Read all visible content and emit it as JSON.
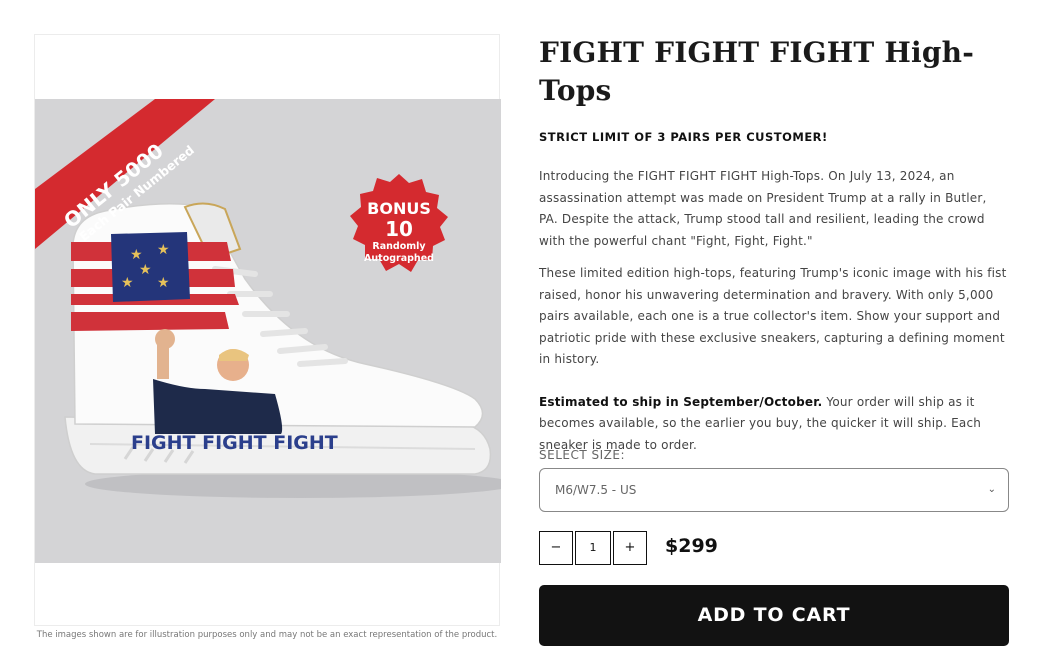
{
  "product": {
    "title": "FIGHT FIGHT FIGHT High-Tops",
    "limit_notice": "STRICT LIMIT OF 3 PAIRS PER CUSTOMER!",
    "description_1": "Introducing the FIGHT FIGHT FIGHT High-Tops. On July 13, 2024, an assassination attempt was made on President Trump at a rally in Butler, PA. Despite the attack, Trump stood tall and resilient, leading the crowd with the powerful chant \"Fight, Fight, Fight.\"",
    "description_2": "These limited edition high-tops, featuring Trump's iconic image with his fist raised, honor his unwavering determination and bravery. With only 5,000 pairs available, each one is a true collector's item. Show your support and patriotic pride with these exclusive sneakers, capturing a defining moment in history.",
    "shipping_bold": "Estimated to ship in September/October.",
    "shipping_text": " Your order will ship as it becomes available, so the earlier you buy, the quicker it will ship. Each sneaker is made to order.",
    "price": "$299"
  },
  "image": {
    "ribbon_line1": "ONLY 5000",
    "ribbon_line2": "Each Pair Numbered",
    "badge_line1": "BONUS",
    "badge_line2": "10",
    "badge_line3": "Randomly",
    "badge_line4": "Autographed",
    "shoe_text": "FIGHT FIGHT FIGHT",
    "caption": "The images shown are for illustration purposes only and may not be an exact representation of the product."
  },
  "size": {
    "label": "SELECT SIZE:",
    "selected": "M6/W7.5 - US",
    "chevron": "⌄"
  },
  "quantity": {
    "minus": "−",
    "value": "1",
    "plus": "+"
  },
  "cart": {
    "add_label": "ADD TO CART"
  },
  "colors": {
    "ribbon_red": "#d42a2f",
    "flag_blue": "#24357a",
    "button_black": "#121212"
  }
}
